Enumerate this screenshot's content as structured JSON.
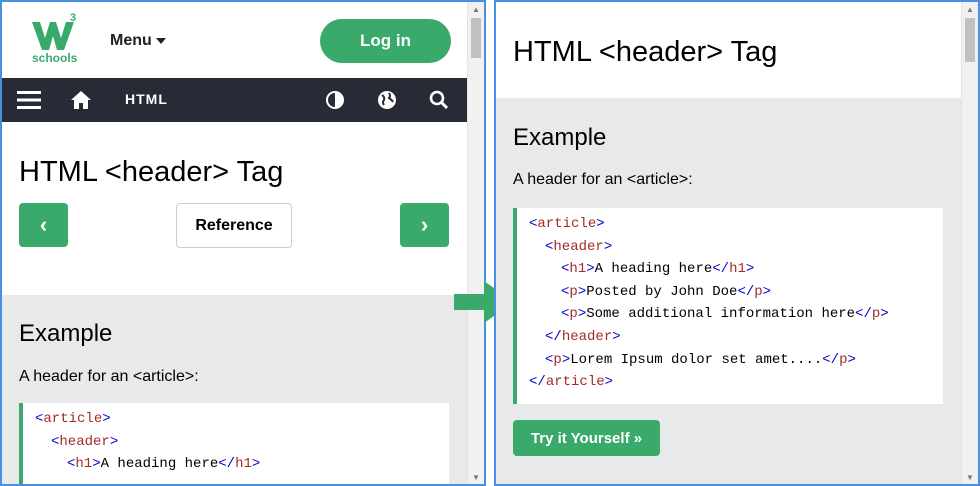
{
  "left": {
    "logo": {
      "text": "schools",
      "superscript": "3"
    },
    "menu_label": "Menu",
    "login_label": "Log in",
    "nav": {
      "html_label": "HTML"
    },
    "title": "HTML <header> Tag",
    "prev_label": "‹",
    "next_label": "›",
    "reference_label": "Reference",
    "example_heading": "Example",
    "example_desc": "A header for an <article>:",
    "code_lines": [
      {
        "indent": 0,
        "open": "<",
        "tag": "article",
        "close": ">",
        "text": ""
      },
      {
        "indent": 1,
        "open": "<",
        "tag": "header",
        "close": ">",
        "text": ""
      },
      {
        "indent": 2,
        "open": "<",
        "tag": "h1",
        "close": ">",
        "text": "A heading here",
        "end_open": "</",
        "end_tag": "h1",
        "end_close": ">"
      }
    ]
  },
  "right": {
    "title": "HTML <header> Tag",
    "example_heading": "Example",
    "example_desc": "A header for an <article>:",
    "code_lines": [
      {
        "indent": 0,
        "open": "<",
        "tag": "article",
        "close": ">",
        "text": ""
      },
      {
        "indent": 1,
        "open": "<",
        "tag": "header",
        "close": ">",
        "text": ""
      },
      {
        "indent": 2,
        "open": "<",
        "tag": "h1",
        "close": ">",
        "text": "A heading here",
        "end_open": "</",
        "end_tag": "h1",
        "end_close": ">"
      },
      {
        "indent": 2,
        "open": "<",
        "tag": "p",
        "close": ">",
        "text": "Posted by John Doe",
        "end_open": "</",
        "end_tag": "p",
        "end_close": ">"
      },
      {
        "indent": 2,
        "open": "<",
        "tag": "p",
        "close": ">",
        "text": "Some additional information here",
        "end_open": "</",
        "end_tag": "p",
        "end_close": ">"
      },
      {
        "indent": 1,
        "open": "</",
        "tag": "header",
        "close": ">",
        "text": ""
      },
      {
        "indent": 1,
        "open": "<",
        "tag": "p",
        "close": ">",
        "text": "Lorem Ipsum dolor set amet....",
        "end_open": "</",
        "end_tag": "p",
        "end_close": ">"
      },
      {
        "indent": 0,
        "open": "</",
        "tag": "article",
        "close": ">",
        "text": ""
      }
    ],
    "try_label": "Try it Yourself »"
  },
  "colors": {
    "accent": "#04AA6D",
    "navbar": "#282A35",
    "grey": "#E7E9EB",
    "tag": "#A52A2A",
    "bracket": "#0000CD",
    "frame": "#4A90E2"
  },
  "icons": [
    "hamburger-icon",
    "home-icon",
    "contrast-icon",
    "globe-icon",
    "search-icon",
    "caret-down-icon",
    "arrow-right-icon"
  ]
}
